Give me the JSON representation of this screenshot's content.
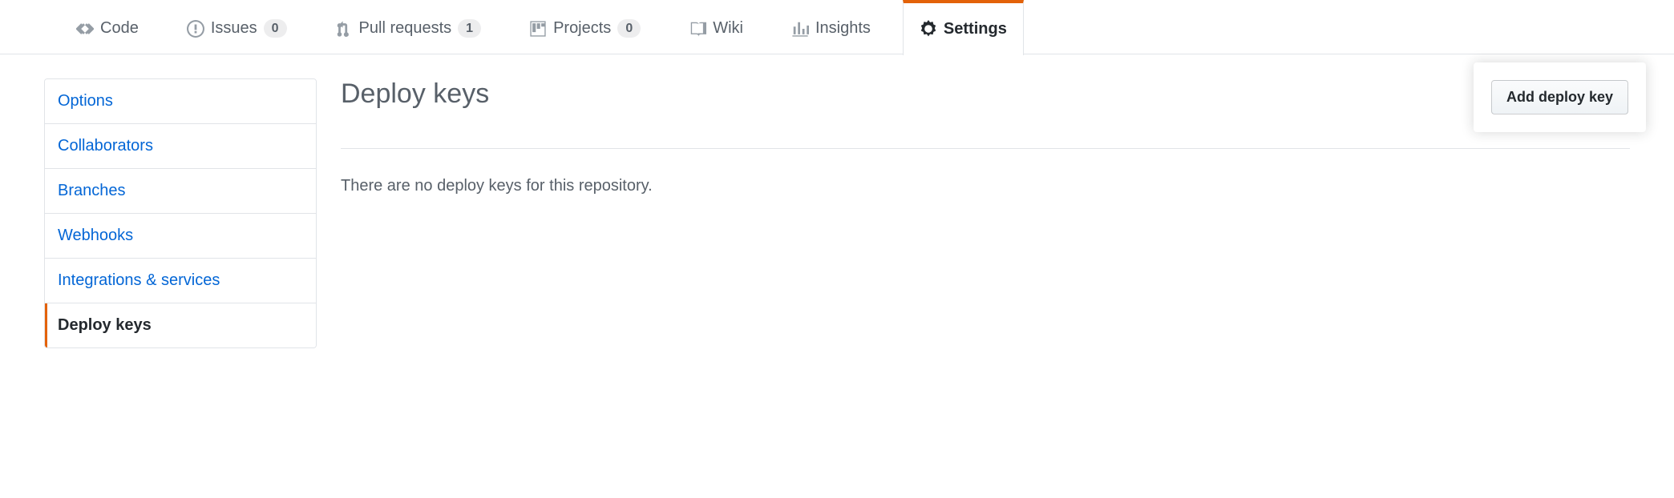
{
  "nav": {
    "code": "Code",
    "issues": "Issues",
    "issues_count": "0",
    "pulls": "Pull requests",
    "pulls_count": "1",
    "projects": "Projects",
    "projects_count": "0",
    "wiki": "Wiki",
    "insights": "Insights",
    "settings": "Settings"
  },
  "sidebar": {
    "items": [
      {
        "label": "Options"
      },
      {
        "label": "Collaborators"
      },
      {
        "label": "Branches"
      },
      {
        "label": "Webhooks"
      },
      {
        "label": "Integrations & services"
      },
      {
        "label": "Deploy keys"
      }
    ]
  },
  "main": {
    "title": "Deploy keys",
    "empty": "There are no deploy keys for this repository.",
    "add_button": "Add deploy key"
  }
}
